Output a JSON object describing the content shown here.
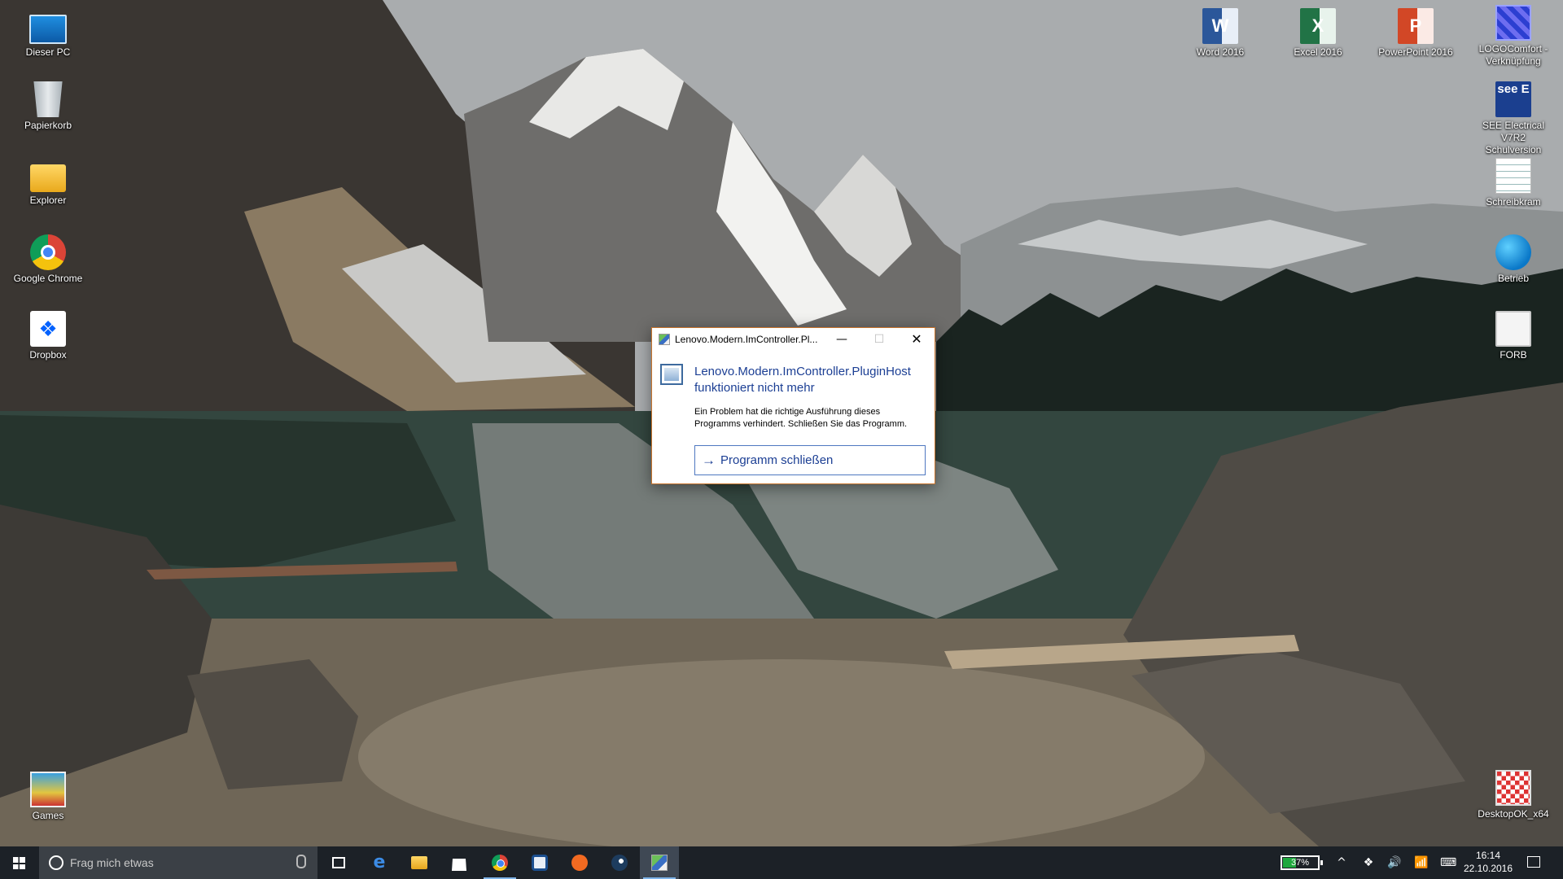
{
  "desktop": {
    "left_icons": [
      {
        "label": "Dieser PC",
        "icon": "computer-icon"
      },
      {
        "label": "Papierkorb",
        "icon": "recycle-bin-icon"
      },
      {
        "label": "Explorer",
        "icon": "folder-icon"
      },
      {
        "label": "Google Chrome",
        "icon": "chrome-icon"
      },
      {
        "label": "Dropbox",
        "icon": "dropbox-icon"
      },
      {
        "label": "Games",
        "icon": "games-icon"
      }
    ],
    "right_icons": [
      {
        "label": "Word 2016",
        "icon": "word-icon",
        "glyph": "W"
      },
      {
        "label": "Excel 2016",
        "icon": "excel-icon",
        "glyph": "X"
      },
      {
        "label": "PowerPoint 2016",
        "icon": "powerpoint-icon",
        "glyph": "P"
      },
      {
        "label_line1": "LOGOComfort -",
        "label_line2": "Verknüpfung",
        "icon": "logocomfort-icon"
      },
      {
        "label_line1": "SEE Electrical V7R2",
        "label_line2": "Schulversion",
        "icon": "see-electrical-icon",
        "glyph": "see E"
      },
      {
        "label": "Schreibkram",
        "icon": "notepad-icon"
      },
      {
        "label": "Betrieb",
        "icon": "betrieb-icon"
      },
      {
        "label": "FORB",
        "icon": "clipboard-icon"
      },
      {
        "label": "DesktopOK_x64",
        "icon": "desktopok-icon"
      }
    ]
  },
  "dialog": {
    "title": "Lenovo.Modern.ImController.Pl...",
    "heading_line1": "Lenovo.Modern.ImController.PluginHost",
    "heading_line2": "funktioniert nicht mehr",
    "message_line1": "Ein Problem hat die richtige Ausführung dieses",
    "message_line2": "Programms verhindert. Schließen Sie das Programm.",
    "action_label": "Programm schließen",
    "minimize_glyph": "—",
    "maximize_glyph": "☐",
    "close_glyph": "✕",
    "border_color": "#c8742c",
    "heading_color": "#1c3f94"
  },
  "taskbar": {
    "search_placeholder": "Frag mich etwas",
    "apps": [
      {
        "name": "task-view",
        "icon": "task-view-icon"
      },
      {
        "name": "edge",
        "icon": "edge-icon",
        "glyph": "e"
      },
      {
        "name": "file-explorer",
        "icon": "folder-icon"
      },
      {
        "name": "store",
        "icon": "store-icon"
      },
      {
        "name": "chrome",
        "icon": "chrome-icon"
      },
      {
        "name": "shield-app",
        "icon": "shield-icon"
      },
      {
        "name": "origin",
        "icon": "origin-icon"
      },
      {
        "name": "steam",
        "icon": "steam-icon"
      },
      {
        "name": "lenovo-plugin-host",
        "icon": "lenovo-app-icon"
      }
    ],
    "battery_percent": "37%",
    "battery_level": 0.37,
    "tray_glyphs": {
      "chevron": "^",
      "volume": "🔊",
      "wifi": "📶",
      "keyboard": "⌨"
    },
    "clock_time": "16:14",
    "clock_date": "22.10.2016",
    "accent_color": "#1fa83e"
  }
}
